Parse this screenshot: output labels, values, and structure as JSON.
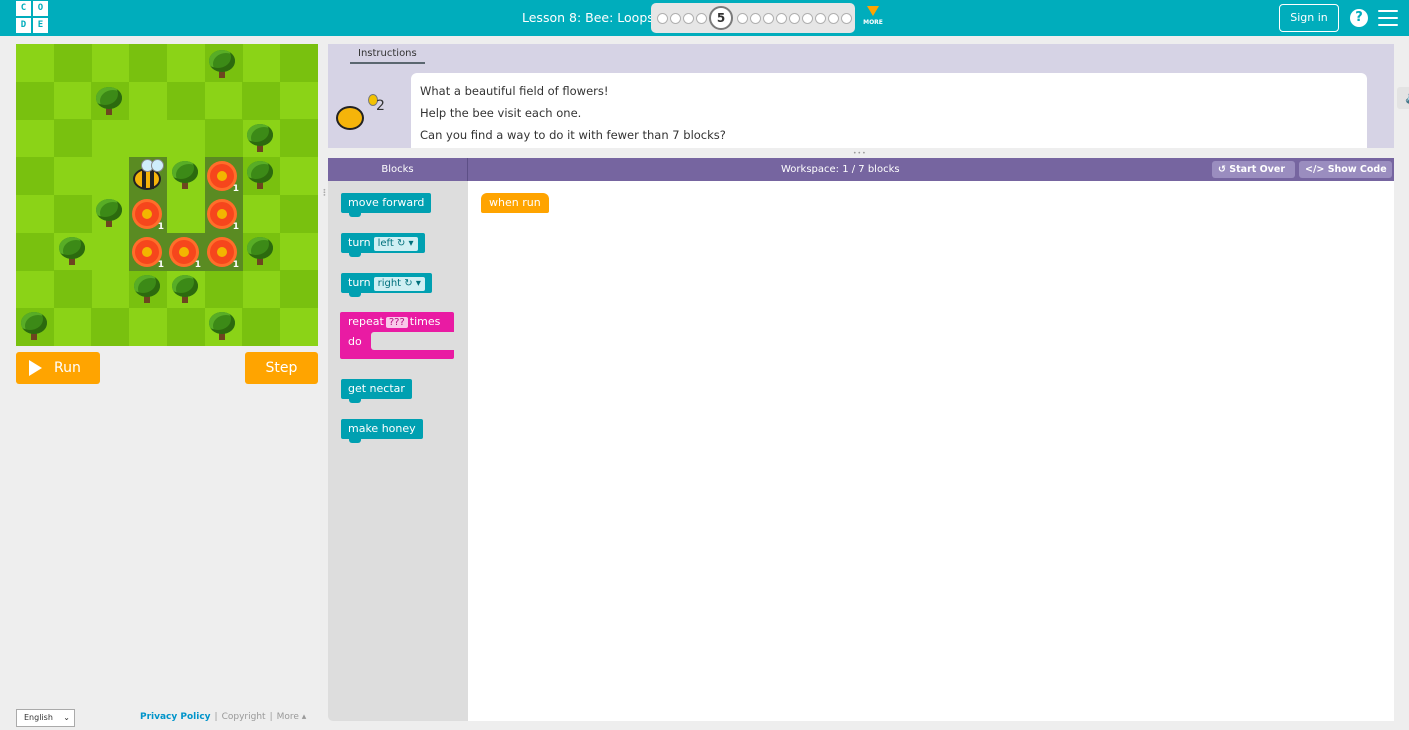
{
  "header": {
    "logo_letters": [
      "C",
      "O",
      "D",
      "E"
    ],
    "lesson_title": "Lesson 8: Bee: Loops",
    "current_level": "5",
    "more_label": "MORE",
    "sign_in_label": "Sign in",
    "help_label": "?",
    "brand_color": "#00adbc"
  },
  "game": {
    "run_label": "Run",
    "step_label": "Step",
    "flower_nectar": "1"
  },
  "footer": {
    "language": "English",
    "privacy": "Privacy Policy",
    "copyright": "Copyright",
    "more": "More ▴"
  },
  "instructions": {
    "tab_label": "Instructions",
    "hint_count": "2",
    "lines": [
      "What a beautiful field of flowers!",
      "Help the bee visit each one.",
      "Can you find a way to do it with fewer than 7 blocks?"
    ]
  },
  "workspace": {
    "blocks_title": "Blocks",
    "title": "Workspace: 1 / 7 blocks",
    "start_over_label": "Start Over",
    "show_code_label": "Show Code"
  },
  "toolbox": {
    "move_forward": "move forward",
    "turn_left_word": "turn",
    "turn_left_value": "left ↻ ▾",
    "turn_right_word": "turn",
    "turn_right_value": "right ↻ ▾",
    "repeat_word": "repeat",
    "repeat_count": "???",
    "repeat_times": "times",
    "repeat_do": "do",
    "get_nectar": "get nectar",
    "make_honey": "make honey"
  },
  "program": {
    "when_run": "when run"
  },
  "colors": {
    "action_block": "#00a0b1",
    "loop_block": "#e91ba3",
    "event_block": "#ffa400",
    "header_purple": "#7665a0"
  }
}
